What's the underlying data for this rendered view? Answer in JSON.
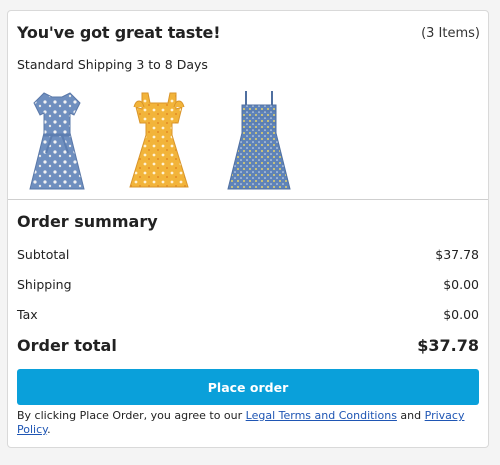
{
  "cart": {
    "title": "You've got great taste!",
    "item_count": "(3 Items)",
    "shipping_note": "Standard Shipping 3 to 8 Days",
    "items": [
      {
        "name": "blue floral dress"
      },
      {
        "name": "yellow floral dress"
      },
      {
        "name": "blue floral smocked dress"
      }
    ]
  },
  "summary": {
    "title": "Order summary",
    "subtotal_label": "Subtotal",
    "subtotal_value": "$37.78",
    "shipping_label": "Shipping",
    "shipping_value": "$0.00",
    "tax_label": "Tax",
    "tax_value": "$0.00",
    "total_label": "Order total",
    "total_value": "$37.78"
  },
  "checkout": {
    "place_order_label": "Place order",
    "legal_prefix": "By clicking Place Order, you agree to our ",
    "legal_terms_link": "Legal Terms and Conditions",
    "legal_and": " and ",
    "legal_privacy_link": "Privacy Policy",
    "legal_suffix": "."
  },
  "colors": {
    "button": "#0aa0da",
    "link": "#1f56b4"
  }
}
